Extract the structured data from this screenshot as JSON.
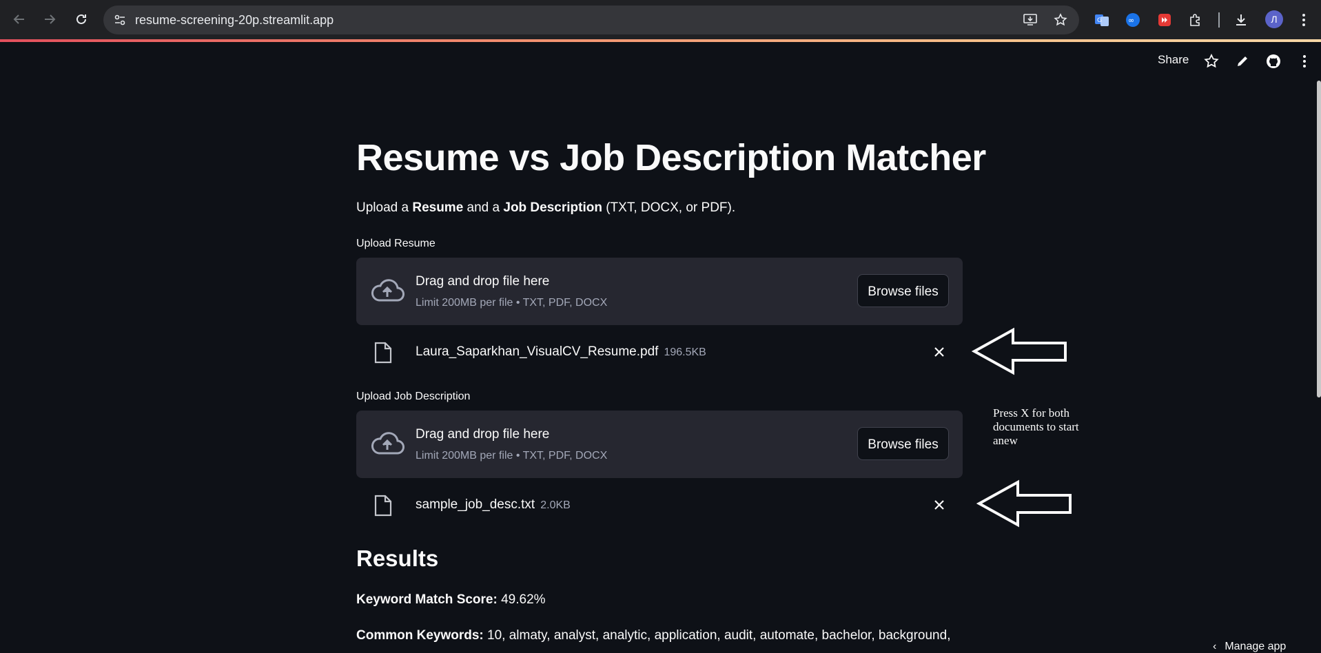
{
  "browser": {
    "url": "resume-screening-20p.streamlit.app",
    "avatar_letter": "Л"
  },
  "toolbar": {
    "share_label": "Share"
  },
  "page": {
    "title": "Resume vs Job Description Matcher",
    "intro": {
      "p1": "Upload a ",
      "b1": "Resume",
      "p2": " and a ",
      "b2": "Job Description",
      "p3": " (TXT, DOCX, or PDF)."
    },
    "resume_uploader": {
      "label": "Upload Resume",
      "drop_title": "Drag and drop file here",
      "drop_sub": "Limit 200MB per file • TXT, PDF, DOCX",
      "browse_label": "Browse files",
      "file_name": "Laura_Saparkhan_VisualCV_Resume.pdf",
      "file_size": "196.5KB"
    },
    "job_uploader": {
      "label": "Upload Job Description",
      "drop_title": "Drag and drop file here",
      "drop_sub": "Limit 200MB per file • TXT, PDF, DOCX",
      "browse_label": "Browse files",
      "file_name": "sample_job_desc.txt",
      "file_size": "2.0KB"
    },
    "annotation_note": "Press X for both documents to start anew",
    "results": {
      "heading": "Results",
      "score_label": "Keyword Match Score:",
      "score_value": " 49.62%",
      "keywords_label": "Common Keywords:",
      "keywords_value": " 10, almaty, analyst, analytic, application, audit, automate, bachelor, background,"
    },
    "manage_app": "Manage app"
  },
  "colors": {
    "background": "#0e1117",
    "dropzone": "#262730",
    "muted_text": "#a3a8b8"
  }
}
